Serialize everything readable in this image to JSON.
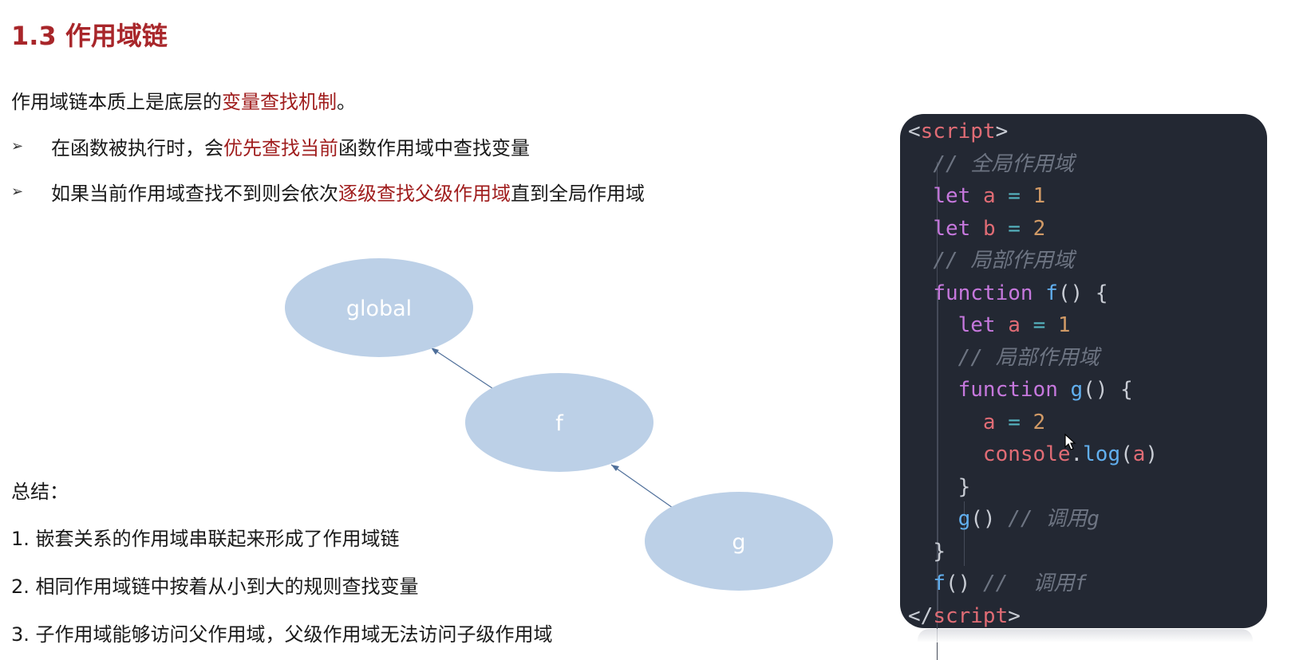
{
  "title": "1.3 作用域链",
  "intro": {
    "prefix": "作用域链本质上是底层的",
    "highlight": "变量查找机制",
    "suffix": "。"
  },
  "bullet_marker": "➢",
  "bullets": [
    {
      "prefix": "在函数被执行时，会",
      "highlight": "优先查找当前",
      "suffix": "函数作用域中查找变量"
    },
    {
      "prefix": "如果当前作用域查找不到则会依次",
      "highlight": "逐级查找父级作用域",
      "suffix": "直到全局作用域"
    }
  ],
  "diagram": {
    "nodes": [
      "global",
      "f",
      "g"
    ],
    "node_color": "#bcd0e7",
    "edge_color": "#4f6f9a"
  },
  "summary": {
    "heading": "总结：",
    "items": [
      "1. 嵌套关系的作用域串联起来形成了作用域链",
      "2. 相同作用域链中按着从小到大的规则查找变量",
      "3. 子作用域能够访问父作用域，父级作用域无法访问子级作用域"
    ]
  },
  "code": {
    "script_open": "script",
    "comment_global": "// 全局作用域",
    "let_kw": "let",
    "var_a": "a",
    "var_b": "b",
    "val_1": "1",
    "val_2": "2",
    "comment_local": "// 局部作用域",
    "function_kw": "function",
    "fn_f": "f",
    "fn_g": "g",
    "console": "console",
    "log": "log",
    "call_g_comment": "// 调用g",
    "call_f_comment": "//  调用f",
    "script_close": "script"
  },
  "colors": {
    "title": "#a8262a",
    "highlight": "#a01e1e",
    "code_bg": "#232833"
  }
}
